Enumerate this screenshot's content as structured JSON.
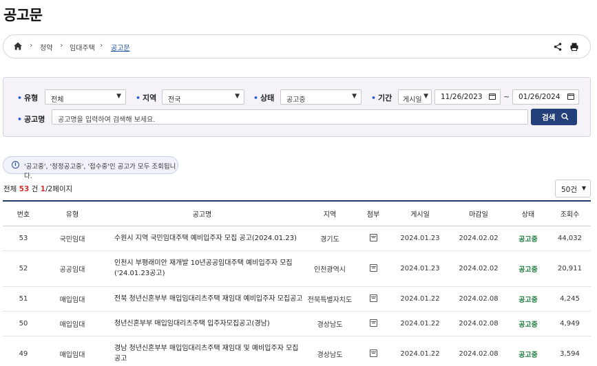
{
  "page": {
    "title": "공고문"
  },
  "breadcrumb": {
    "items": [
      "청약",
      "임대주택",
      "공고문"
    ]
  },
  "search": {
    "type_label": "유형",
    "type_value": "전체",
    "region_label": "지역",
    "region_value": "전국",
    "status_label": "상태",
    "status_value": "공고중",
    "period_label": "기간",
    "period_kind": "게시일",
    "date_from": "11/26/2023",
    "date_sep": "~",
    "date_to": "01/26/2024",
    "name_label": "공고명",
    "name_placeholder": "공고명을 입력하여 검색해 보세요.",
    "button_label": "검색"
  },
  "notice": {
    "text": "'공고중', '정정공고중', '접수중'인 공고가 모두 조회됩니다."
  },
  "summary": {
    "prefix": "전체 ",
    "total": "53",
    "unit": " 건 ",
    "current_page": "1",
    "page_rest": "/2페이지"
  },
  "page_size": {
    "value": "50건"
  },
  "table": {
    "headers": [
      "번호",
      "유형",
      "공고명",
      "지역",
      "첨부",
      "게시일",
      "마감일",
      "상태",
      "조회수"
    ],
    "rows": [
      {
        "no": "53",
        "type": "국민임대",
        "title": "수원시 지역 국민임대주택 예비입주자 모집 공고(2024.01.23)",
        "region": "경기도",
        "posted": "2024.01.23",
        "deadline": "2024.02.02",
        "status": "공고중",
        "views": "44,032"
      },
      {
        "no": "52",
        "type": "공공임대",
        "title": "인천시 부평래미안 재개발 10년공공임대주택 예비입주자 모집('24.01.23공고)",
        "region": "인천광역시",
        "posted": "2024.01.23",
        "deadline": "2024.02.02",
        "status": "공고중",
        "views": "20,911"
      },
      {
        "no": "51",
        "type": "매입임대",
        "title": "전북 청년신혼부부 매입임대리츠주택 재임대 예비입주자 모집공고",
        "region": "전북특별자치도",
        "posted": "2024.01.22",
        "deadline": "2024.02.08",
        "status": "공고중",
        "views": "4,245"
      },
      {
        "no": "50",
        "type": "매입임대",
        "title": "청년신혼부부 매입임대리츠주택 입주자모집공고(경남)",
        "region": "경상남도",
        "posted": "2024.01.22",
        "deadline": "2024.02.08",
        "status": "공고중",
        "views": "4,949"
      },
      {
        "no": "49",
        "type": "매입임대",
        "title": "경남 청년신혼부부 매입임대리츠주택 재임대 및 예비입주자 모집공고",
        "region": "경상남도",
        "posted": "2024.01.22",
        "deadline": "2024.02.08",
        "status": "공고중",
        "views": "3,594"
      }
    ]
  }
}
